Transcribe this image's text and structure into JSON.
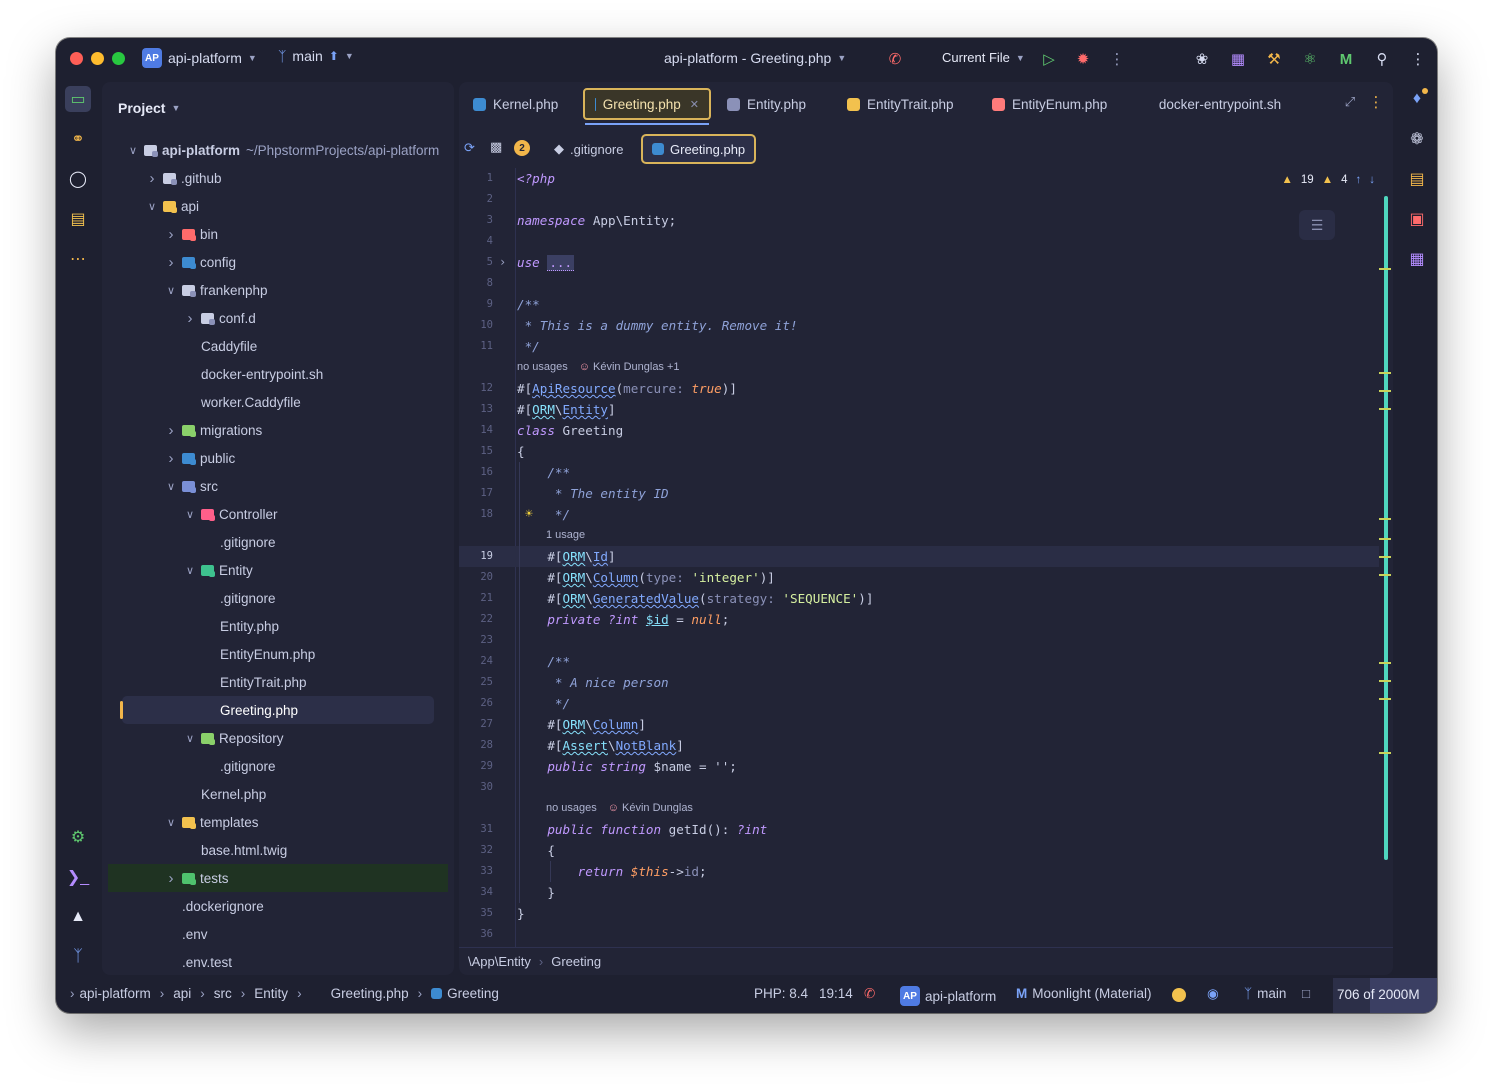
{
  "colors": {
    "window_bg": "#1e2030",
    "panel_bg": "#222436",
    "accent": "#d9b45a",
    "keyword": "#c099ff",
    "string": "#d6f0a0",
    "scrollbar": "#4fd6be"
  },
  "titlebar": {
    "project_badge": "AP",
    "project_name": "api-platform",
    "branch": "main",
    "window_title": "api-platform - Greeting.php",
    "run_config": "Current File",
    "icons": [
      "phone-icon",
      "run-icon",
      "debug-icon",
      "more-icon",
      "ai-assistant-icon",
      "plugin-icon",
      "build-tools-icon",
      "react-icon",
      "framework-icon",
      "search-icon",
      "menu-icon"
    ]
  },
  "left_tools": [
    "project-view-icon",
    "commit-icon",
    "github-icon",
    "structure-icon",
    "more-tools-icon",
    "settings-icon",
    "terminal-icon",
    "services-icon",
    "git-icon"
  ],
  "project": {
    "title": "Project",
    "tree": [
      {
        "label": "api-platform",
        "path": "~/PhpstormProjects/api-platform",
        "depth": 0,
        "chev": "open",
        "icon": "#8b91b8",
        "bold": true
      },
      {
        "label": ".github",
        "depth": 1,
        "chev": "closed",
        "icon": "#8b91b8"
      },
      {
        "label": "api",
        "depth": 1,
        "chev": "open",
        "icon": "#f2c14e"
      },
      {
        "label": "bin",
        "depth": 2,
        "chev": "closed",
        "icon": "#ff6b6b"
      },
      {
        "label": "config",
        "depth": 2,
        "chev": "closed",
        "icon": "#3d8bd1"
      },
      {
        "label": "frankenphp",
        "depth": 2,
        "chev": "open",
        "icon": "#8b91b8"
      },
      {
        "label": "conf.d",
        "depth": 3,
        "chev": "closed",
        "icon": "#8b91b8"
      },
      {
        "label": "Caddyfile",
        "depth": 3,
        "chev": "none",
        "icon": "none"
      },
      {
        "label": "docker-entrypoint.sh",
        "depth": 3,
        "chev": "none",
        "icon": "none"
      },
      {
        "label": "worker.Caddyfile",
        "depth": 3,
        "chev": "none",
        "icon": "none"
      },
      {
        "label": "migrations",
        "depth": 2,
        "chev": "closed",
        "icon": "#8ad06a"
      },
      {
        "label": "public",
        "depth": 2,
        "chev": "closed",
        "icon": "#3d8bd1"
      },
      {
        "label": "src",
        "depth": 2,
        "chev": "open",
        "icon": "#7a8fd6"
      },
      {
        "label": "Controller",
        "depth": 3,
        "chev": "open",
        "icon": "#ff5f8a"
      },
      {
        "label": ".gitignore",
        "depth": 4,
        "chev": "none",
        "icon": "none"
      },
      {
        "label": "Entity",
        "depth": 3,
        "chev": "open",
        "icon": "#3ec28f"
      },
      {
        "label": ".gitignore",
        "depth": 4,
        "chev": "none",
        "icon": "none"
      },
      {
        "label": "Entity.php",
        "depth": 4,
        "chev": "none",
        "icon": "none"
      },
      {
        "label": "EntityEnum.php",
        "depth": 4,
        "chev": "none",
        "icon": "none"
      },
      {
        "label": "EntityTrait.php",
        "depth": 4,
        "chev": "none",
        "icon": "none"
      },
      {
        "label": "Greeting.php",
        "depth": 4,
        "chev": "none",
        "icon": "none",
        "selected": true
      },
      {
        "label": "Repository",
        "depth": 3,
        "chev": "open",
        "icon": "#8ad06a"
      },
      {
        "label": ".gitignore",
        "depth": 4,
        "chev": "none",
        "icon": "none"
      },
      {
        "label": "Kernel.php",
        "depth": 3,
        "chev": "none",
        "icon": "none"
      },
      {
        "label": "templates",
        "depth": 2,
        "chev": "open",
        "icon": "#f2c14e"
      },
      {
        "label": "base.html.twig",
        "depth": 3,
        "chev": "none",
        "icon": "none"
      },
      {
        "label": "tests",
        "depth": 2,
        "chev": "closed",
        "icon": "#4fc26d",
        "highlight": true
      },
      {
        "label": ".dockerignore",
        "depth": 2,
        "chev": "none",
        "icon": "none"
      },
      {
        "label": ".env",
        "depth": 2,
        "chev": "none",
        "icon": "none"
      },
      {
        "label": ".env.test",
        "depth": 2,
        "chev": "none",
        "icon": "none"
      }
    ]
  },
  "tabs": [
    {
      "label": "Kernel.php",
      "icon": "#3d8bd1",
      "active": false
    },
    {
      "label": "Greeting.php",
      "icon": "#3d8bd1",
      "active": true
    },
    {
      "label": "Entity.php",
      "icon": "#8b91b8",
      "active": false
    },
    {
      "label": "EntityTrait.php",
      "icon": "#f2c14e",
      "active": false
    },
    {
      "label": "EntityEnum.php",
      "icon": "#ff7b7b",
      "active": false
    },
    {
      "label": "docker-entrypoint.sh",
      "icon": "none",
      "active": false
    }
  ],
  "navbar": {
    "badge_count": "2",
    "chip1": ".gitignore",
    "chip2": "Greeting.php"
  },
  "inspections": {
    "warnings": "19",
    "weak_warnings": "4"
  },
  "code": {
    "current_line": 19,
    "lines": [
      {
        "n": 1,
        "spans": [
          {
            "t": "<?php",
            "c": "kw"
          }
        ]
      },
      {
        "n": 2,
        "spans": []
      },
      {
        "n": 3,
        "spans": [
          {
            "t": "namespace",
            "c": "kw"
          },
          {
            "t": " App\\Entity;",
            "c": ""
          }
        ]
      },
      {
        "n": 4,
        "spans": []
      },
      {
        "n": 5,
        "spans": [
          {
            "t": "use",
            "c": "kw"
          },
          {
            "t": " ",
            "c": ""
          },
          {
            "t": "...",
            "c": "fold"
          }
        ]
      },
      {
        "n": 8,
        "spans": []
      },
      {
        "n": 9,
        "spans": [
          {
            "t": "/**",
            "c": "cm"
          }
        ]
      },
      {
        "n": 10,
        "spans": [
          {
            "t": " * This is a dummy entity. Remove it!",
            "c": "cm"
          }
        ]
      },
      {
        "n": 11,
        "spans": [
          {
            "t": " */",
            "c": "cm"
          }
        ]
      },
      {
        "n": 12,
        "spans": [
          {
            "t": "#[",
            "c": ""
          },
          {
            "t": "ApiResource",
            "c": "attr2"
          },
          {
            "t": "(",
            "c": ""
          },
          {
            "t": "mercure: ",
            "c": "prm"
          },
          {
            "t": "true",
            "c": "nul"
          },
          {
            "t": ")]",
            "c": ""
          }
        ]
      },
      {
        "n": 13,
        "spans": [
          {
            "t": "#[",
            "c": ""
          },
          {
            "t": "ORM",
            "c": "attr"
          },
          {
            "t": "\\",
            "c": ""
          },
          {
            "t": "Entity",
            "c": "attr2"
          },
          {
            "t": "]",
            "c": ""
          }
        ]
      },
      {
        "n": 14,
        "spans": [
          {
            "t": "class",
            "c": "kw"
          },
          {
            "t": " Greeting",
            "c": ""
          }
        ]
      },
      {
        "n": 15,
        "spans": [
          {
            "t": "{",
            "c": ""
          }
        ]
      },
      {
        "n": 16,
        "spans": [
          {
            "t": "    /**",
            "c": "cm"
          }
        ]
      },
      {
        "n": 17,
        "spans": [
          {
            "t": "     * The entity ID",
            "c": "cm"
          }
        ]
      },
      {
        "n": 18,
        "spans": [
          {
            "t": "     */",
            "c": "cm"
          }
        ]
      },
      {
        "n": 19,
        "spans": [
          {
            "t": "    #[",
            "c": ""
          },
          {
            "t": "ORM",
            "c": "attr"
          },
          {
            "t": "\\",
            "c": ""
          },
          {
            "t": "Id",
            "c": "attr2"
          },
          {
            "t": "]",
            "c": ""
          }
        ]
      },
      {
        "n": 20,
        "spans": [
          {
            "t": "    #[",
            "c": ""
          },
          {
            "t": "ORM",
            "c": "attr"
          },
          {
            "t": "\\",
            "c": ""
          },
          {
            "t": "Column",
            "c": "attr2"
          },
          {
            "t": "(",
            "c": ""
          },
          {
            "t": "type: ",
            "c": "prm"
          },
          {
            "t": "'integer'",
            "c": "str"
          },
          {
            "t": ")]",
            "c": ""
          }
        ]
      },
      {
        "n": 21,
        "spans": [
          {
            "t": "    #[",
            "c": ""
          },
          {
            "t": "ORM",
            "c": "attr"
          },
          {
            "t": "\\",
            "c": ""
          },
          {
            "t": "GeneratedValue",
            "c": "attr2"
          },
          {
            "t": "(",
            "c": ""
          },
          {
            "t": "strategy: ",
            "c": "prm"
          },
          {
            "t": "'SEQUENCE'",
            "c": "str"
          },
          {
            "t": ")]",
            "c": ""
          }
        ]
      },
      {
        "n": 22,
        "spans": [
          {
            "t": "    private ?int ",
            "c": "kw"
          },
          {
            "t": "$id",
            "c": "var"
          },
          {
            "t": " = ",
            "c": ""
          },
          {
            "t": "null",
            "c": "nul"
          },
          {
            "t": ";",
            "c": ""
          }
        ]
      },
      {
        "n": 23,
        "spans": []
      },
      {
        "n": 24,
        "spans": [
          {
            "t": "    /**",
            "c": "cm"
          }
        ]
      },
      {
        "n": 25,
        "spans": [
          {
            "t": "     * A nice person",
            "c": "cm"
          }
        ]
      },
      {
        "n": 26,
        "spans": [
          {
            "t": "     */",
            "c": "cm"
          }
        ]
      },
      {
        "n": 27,
        "spans": [
          {
            "t": "    #[",
            "c": ""
          },
          {
            "t": "ORM",
            "c": "attr"
          },
          {
            "t": "\\",
            "c": ""
          },
          {
            "t": "Column",
            "c": "attr2"
          },
          {
            "t": "]",
            "c": ""
          }
        ]
      },
      {
        "n": 28,
        "spans": [
          {
            "t": "    #[",
            "c": ""
          },
          {
            "t": "Assert",
            "c": "attr"
          },
          {
            "t": "\\",
            "c": ""
          },
          {
            "t": "NotBlank",
            "c": "attr2"
          },
          {
            "t": "]",
            "c": ""
          }
        ]
      },
      {
        "n": 29,
        "spans": [
          {
            "t": "    public string ",
            "c": "kw"
          },
          {
            "t": "$name = '';",
            "c": ""
          }
        ]
      },
      {
        "n": 30,
        "spans": []
      },
      {
        "n": 31,
        "spans": [
          {
            "t": "    public function ",
            "c": "kw"
          },
          {
            "t": "getId(): ",
            "c": ""
          },
          {
            "t": "?int",
            "c": "kw"
          }
        ]
      },
      {
        "n": 32,
        "spans": [
          {
            "t": "    {",
            "c": ""
          }
        ]
      },
      {
        "n": 33,
        "spans": [
          {
            "t": "        return ",
            "c": "kw"
          },
          {
            "t": "$this",
            "c": "nul"
          },
          {
            "t": "->",
            "c": ""
          },
          {
            "t": "id",
            "c": "prm"
          },
          {
            "t": ";",
            "c": ""
          }
        ]
      },
      {
        "n": 34,
        "spans": [
          {
            "t": "    }",
            "c": ""
          }
        ]
      },
      {
        "n": 35,
        "spans": [
          {
            "t": "}",
            "c": ""
          }
        ]
      },
      {
        "n": 36,
        "spans": []
      }
    ],
    "inlays": [
      {
        "before_line": 12,
        "text": "no usages",
        "author": "Kévin Dunglas +1",
        "indent": 0
      },
      {
        "before_line": 19,
        "text": "1 usage",
        "author": "",
        "indent": 1
      },
      {
        "before_line": 31,
        "text": "no usages",
        "author": "Kévin Dunglas",
        "indent": 1
      }
    ]
  },
  "editor_footer": {
    "namespace": "\\App\\Entity",
    "class": "Greeting"
  },
  "right_tools": [
    "notifications-icon",
    "ai-chat-icon",
    "database-icon",
    "bookmarks-icon",
    "plugin-icon"
  ],
  "statusbar": {
    "breadcrumb": [
      "api-platform",
      "api",
      "src",
      "Entity",
      "Greeting.php",
      "Greeting"
    ],
    "php_version": "PHP: 8.4",
    "cursor": "19:14",
    "project_badge": "AP",
    "project": "api-platform",
    "theme": "Moonlight (Material)",
    "branch": "main",
    "memory": "706 of 2000M",
    "memory_fraction": 0.353
  }
}
